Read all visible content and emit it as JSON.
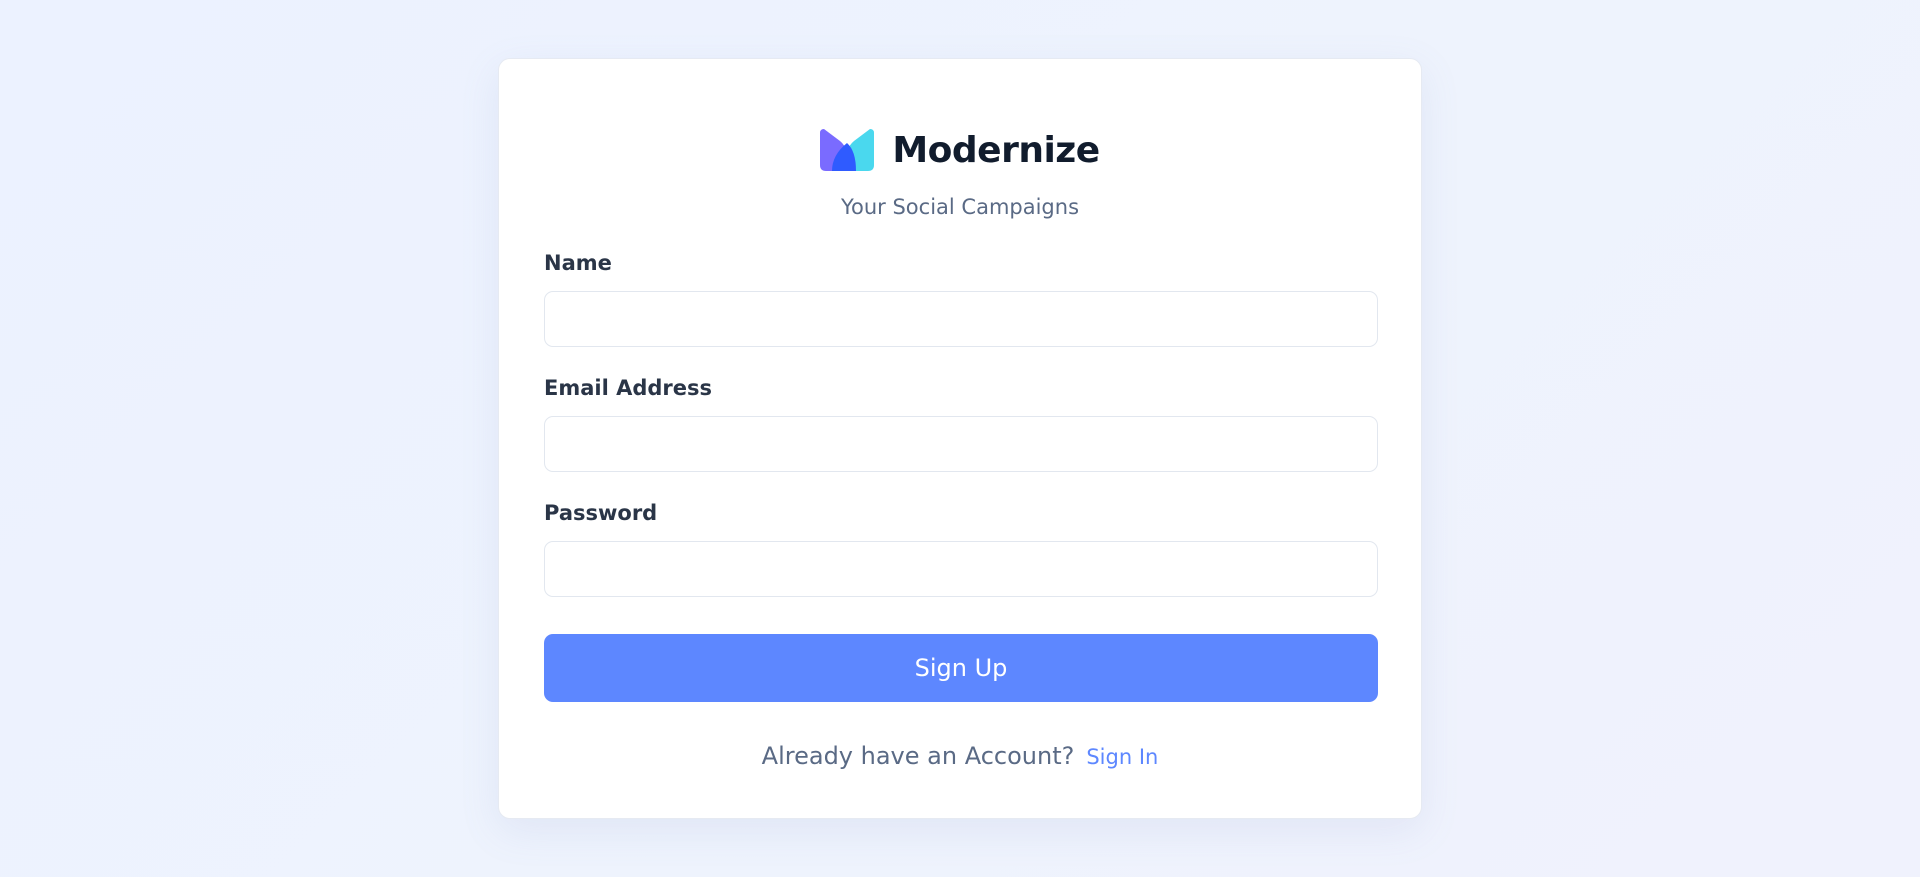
{
  "brand": {
    "name": "Modernize",
    "tagline": "Your Social Campaigns",
    "logo_icon": "modernize-logo-icon",
    "logo_colors": [
      "#7a6bff",
      "#4ad8ee",
      "#2f5bff"
    ]
  },
  "form": {
    "name_label": "Name",
    "name_value": "",
    "email_label": "Email Address",
    "email_value": "",
    "password_label": "Password",
    "password_value": "",
    "submit_label": "Sign Up"
  },
  "footer": {
    "prompt": "Already have an Account?",
    "signin_label": "Sign In"
  },
  "colors": {
    "accent": "#5d87ff",
    "text_dark": "#2a3547",
    "text_muted": "#5a6a85",
    "background": "#ecf2ff"
  }
}
